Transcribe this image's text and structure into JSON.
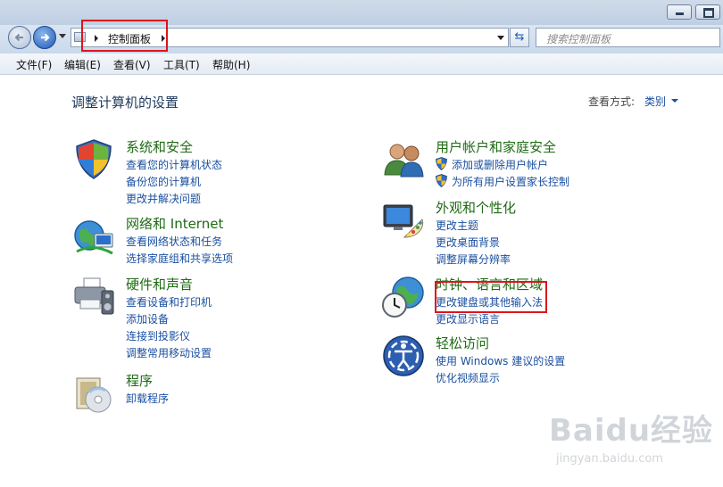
{
  "window": {
    "address": {
      "breadcrumb": "控制面板"
    },
    "search": {
      "placeholder": "搜索控制面板"
    }
  },
  "menu": [
    "文件(F)",
    "编辑(E)",
    "查看(V)",
    "工具(T)",
    "帮助(H)"
  ],
  "page": {
    "title": "调整计算机的设置",
    "view_by_label": "查看方式:",
    "view_by_value": "类别"
  },
  "categories": [
    {
      "title": "系统和安全",
      "icon": "shield-icon",
      "links": [
        "查看您的计算机状态",
        "备份您的计算机",
        "更改并解决问题"
      ]
    },
    {
      "title": "网络和 Internet",
      "icon": "network-globe-icon",
      "links": [
        "查看网络状态和任务",
        "选择家庭组和共享选项"
      ]
    },
    {
      "title": "硬件和声音",
      "icon": "printer-speaker-icon",
      "links": [
        "查看设备和打印机",
        "添加设备",
        "连接到投影仪",
        "调整常用移动设置"
      ]
    },
    {
      "title": "程序",
      "icon": "programs-disc-icon",
      "links": [
        "卸载程序"
      ]
    },
    {
      "title": "用户帐户和家庭安全",
      "icon": "users-icon",
      "links": [
        "添加或删除用户帐户",
        "为所有用户设置家长控制"
      ]
    },
    {
      "title": "外观和个性化",
      "icon": "monitor-palette-icon",
      "links": [
        "更改主题",
        "更改桌面背景",
        "调整屏幕分辨率"
      ]
    },
    {
      "title": "时钟、语言和区域",
      "icon": "clock-globe-icon",
      "links": [
        "更改键盘或其他输入法",
        "更改显示语言"
      ]
    },
    {
      "title": "轻松访问",
      "icon": "ease-of-access-icon",
      "links": [
        "使用 Windows 建议的设置",
        "优化视频显示"
      ]
    }
  ],
  "watermark": {
    "brand": "Baidu经验",
    "url": "jingyan.baidu.com"
  },
  "colors": {
    "category_title": "#1e6b14",
    "link": "#1a4fa0",
    "highlight": "#e0141b"
  }
}
